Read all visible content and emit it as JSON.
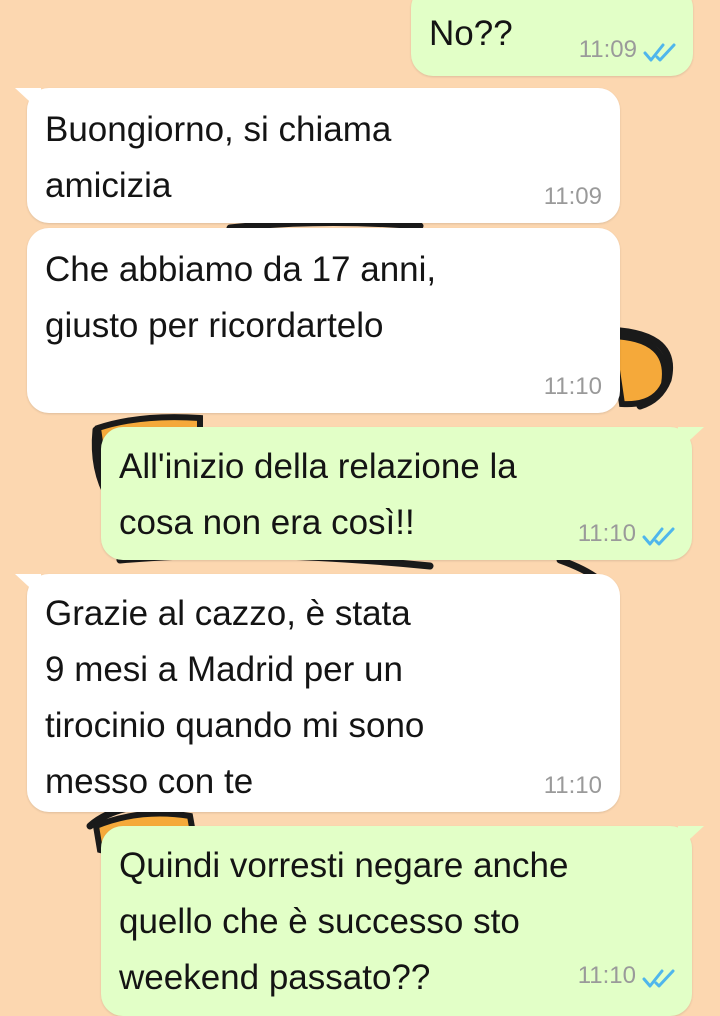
{
  "chat": {
    "messages": [
      {
        "direction": "out",
        "text": "No??",
        "time": "11:09",
        "status": "read"
      },
      {
        "direction": "in",
        "text": "Buongiorno, si chiama\namicizia",
        "time": "11:09"
      },
      {
        "direction": "in",
        "text": "Che abbiamo da 17 anni,\ngiusto per ricordartelo",
        "time": "11:10"
      },
      {
        "direction": "out",
        "text": "All'inizio della relazione la\ncosa non era così!!",
        "time": "11:10",
        "status": "read"
      },
      {
        "direction": "in",
        "text": "Grazie al cazzo, è stata\n9 mesi a Madrid per un\ntirocinio quando mi sono\nmesso con te",
        "time": "11:10"
      },
      {
        "direction": "out",
        "text": "Quindi vorresti negare anche\nquello che è successo sto\nweekend passato??",
        "time": "11:10",
        "status": "read"
      }
    ]
  },
  "colors": {
    "wallpaper": "#fcd7b0",
    "incoming_bubble": "#ffffff",
    "outgoing_bubble": "#e2ffc7",
    "read_check": "#4fb6ec",
    "time_text": "#9a9a9a"
  },
  "icons": {
    "read_receipt": "double-check-icon"
  }
}
